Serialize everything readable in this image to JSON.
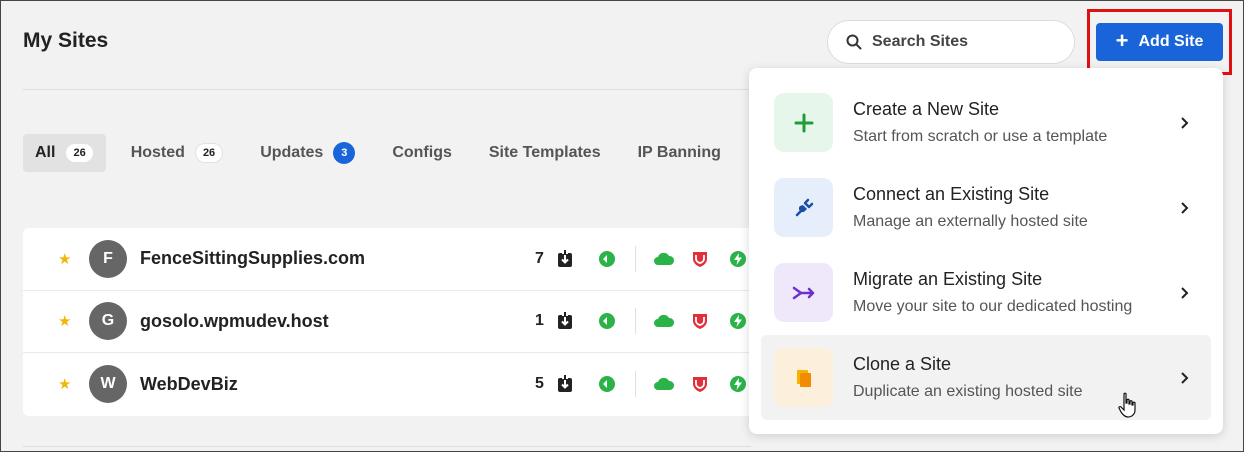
{
  "header": {
    "title": "My Sites",
    "search_placeholder": "Search Sites",
    "add_site_label": "Add Site"
  },
  "tabs": [
    {
      "label": "All",
      "count": "26",
      "active": true
    },
    {
      "label": "Hosted",
      "count": "26"
    },
    {
      "label": "Updates",
      "count": "3",
      "badge_color": "#1a64d9"
    },
    {
      "label": "Configs"
    },
    {
      "label": "Site Templates"
    },
    {
      "label": "IP Banning"
    }
  ],
  "sites": [
    {
      "initial": "F",
      "name": "FenceSittingSupplies.com",
      "updates": "7"
    },
    {
      "initial": "G",
      "name": "gosolo.wpmudev.host",
      "updates": "1"
    },
    {
      "initial": "W",
      "name": "WebDevBiz",
      "updates": "5"
    }
  ],
  "dropdown": {
    "items": [
      {
        "title": "Create a New Site",
        "subtitle": "Start from scratch or use a template",
        "icon": "plus-icon",
        "bg": "#e6f6ea",
        "fg": "#1f9d3a"
      },
      {
        "title": "Connect an Existing Site",
        "subtitle": "Manage an externally hosted site",
        "icon": "plug-icon",
        "bg": "#e6eefb",
        "fg": "#1a4fa8"
      },
      {
        "title": "Migrate an Existing Site",
        "subtitle": "Move your site to our dedicated hosting",
        "icon": "migrate-icon",
        "bg": "#efe8fa",
        "fg": "#6b32c9"
      },
      {
        "title": "Clone a Site",
        "subtitle": "Duplicate an existing hosted site",
        "icon": "clone-icon",
        "bg": "#fcf0dc",
        "fg": "#f0a000"
      }
    ]
  },
  "colors": {
    "accent": "#1a64d9",
    "highlight_border": "#e01010",
    "star": "#f2b705",
    "green": "#2bb34a",
    "red": "#e0303a"
  }
}
